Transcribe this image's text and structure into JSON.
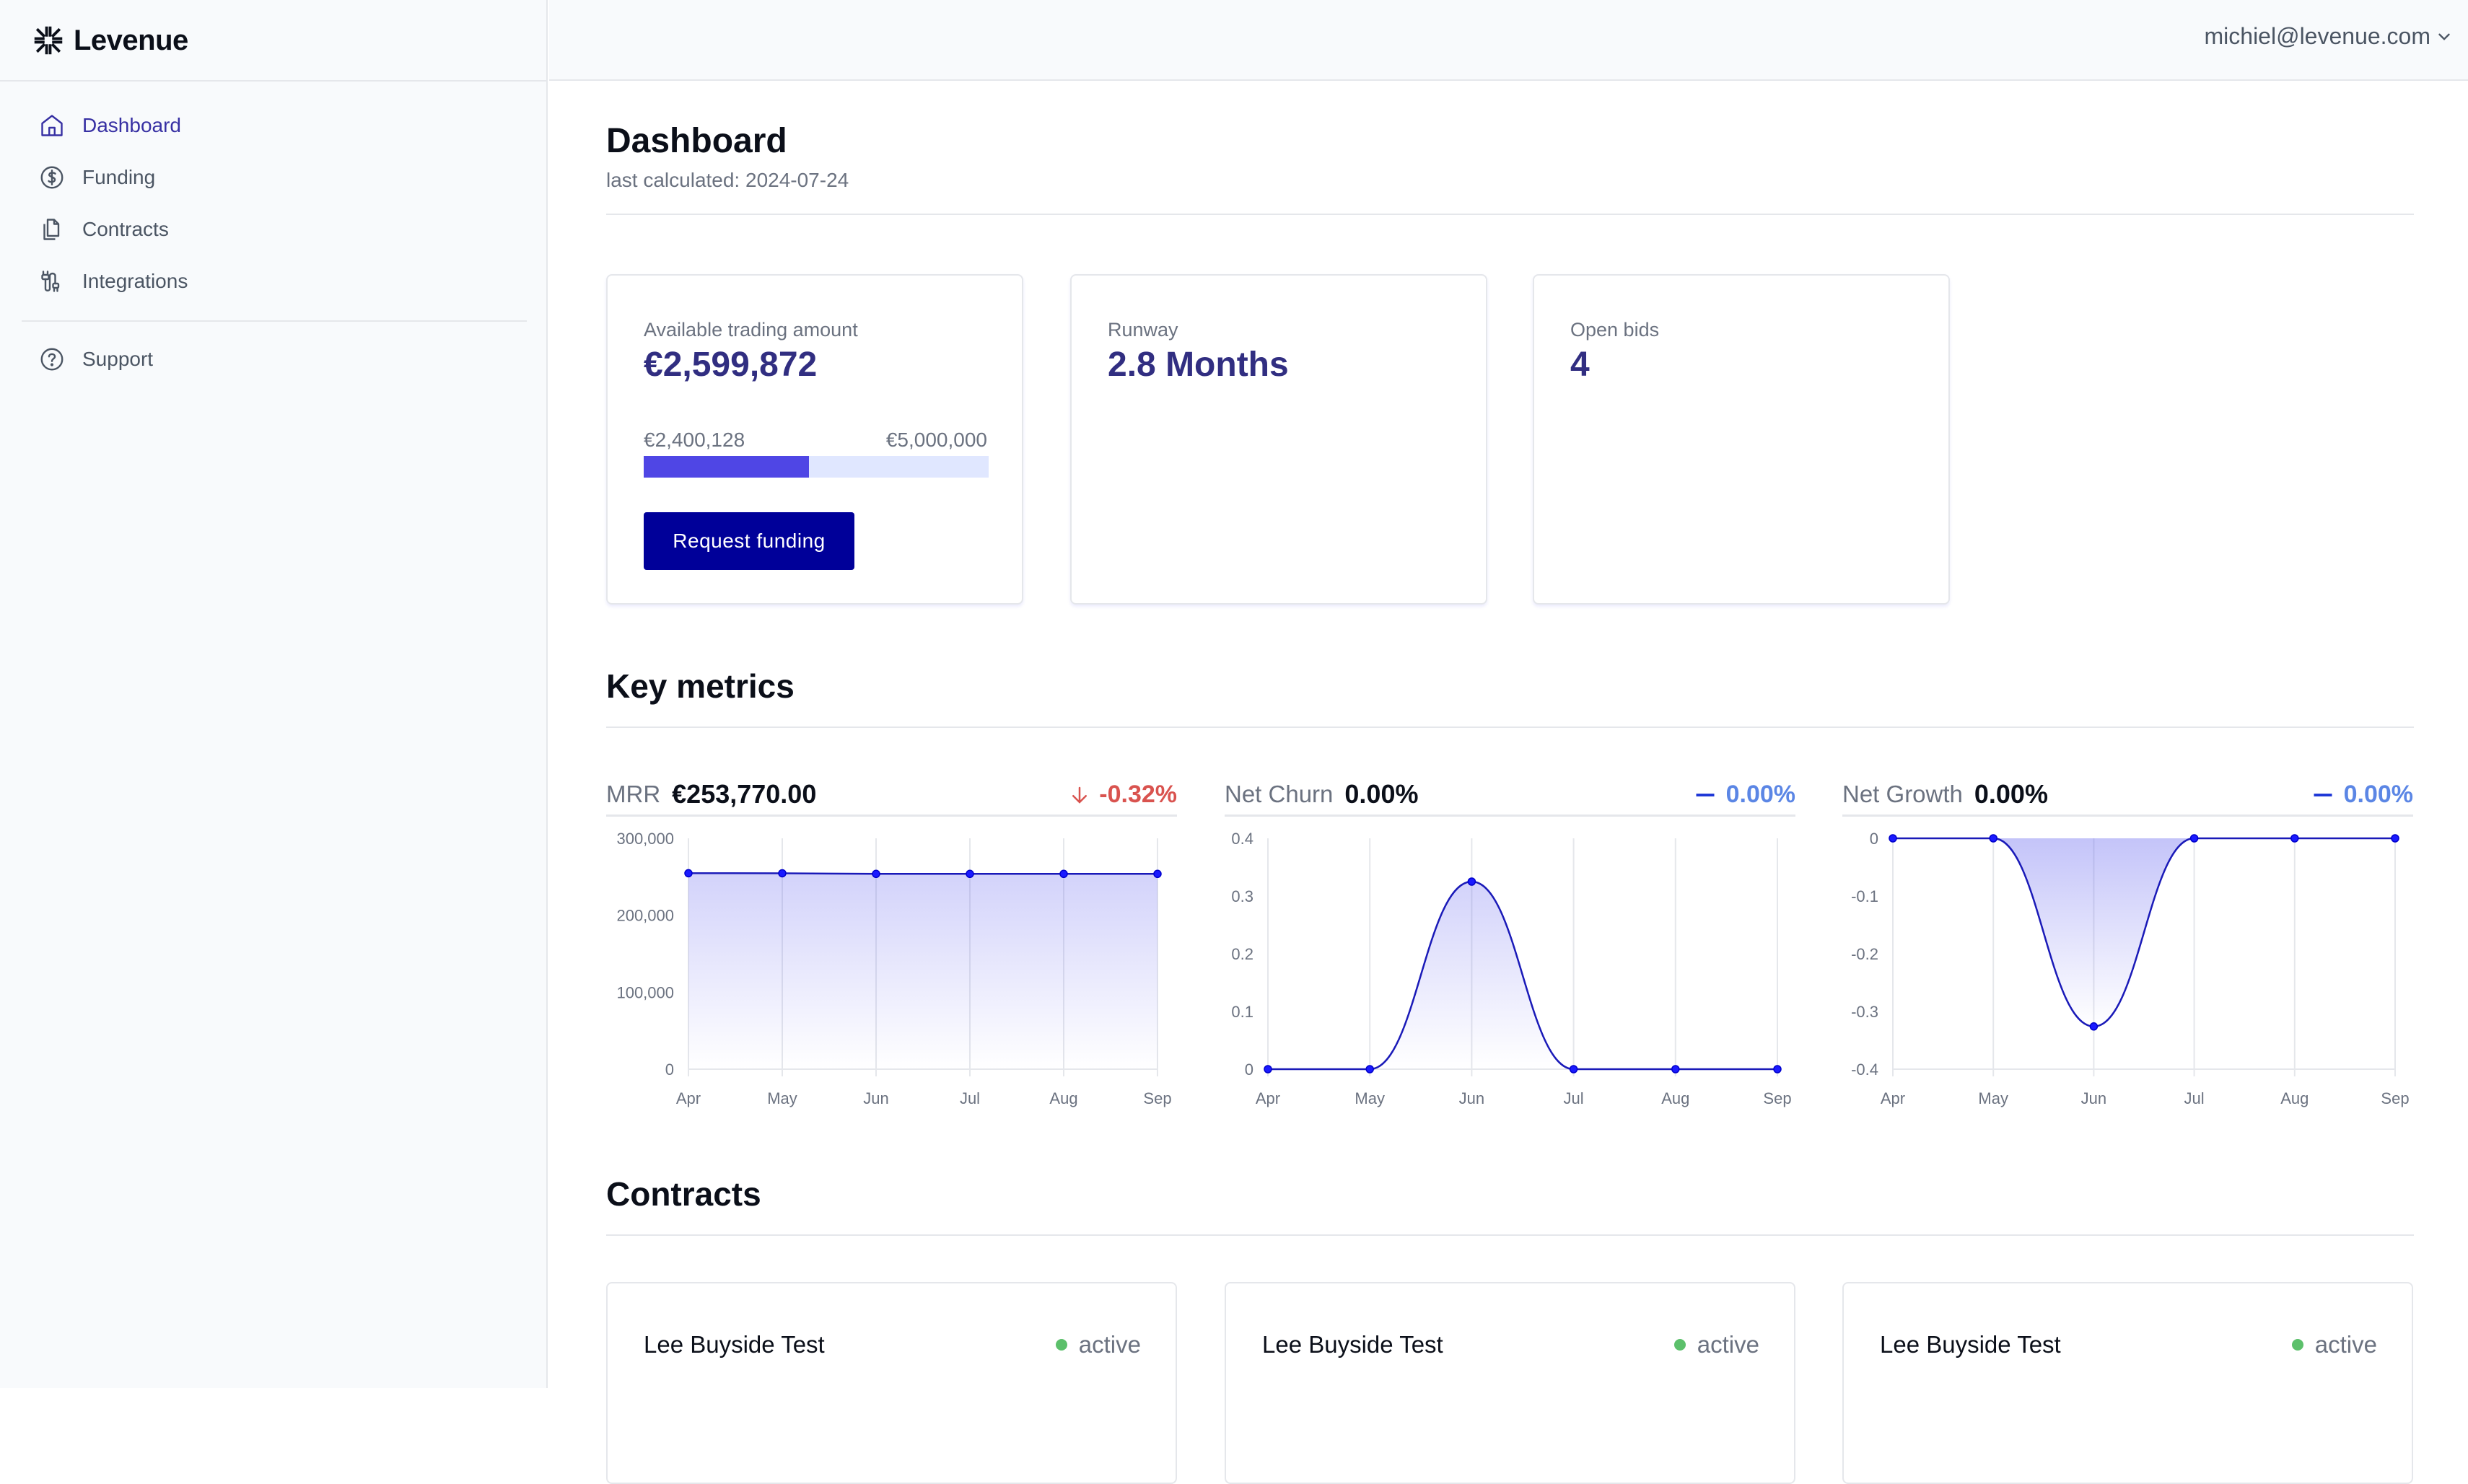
{
  "app": {
    "name": "Levenue"
  },
  "sidebar": {
    "items": [
      {
        "label": "Dashboard",
        "icon": "home-icon",
        "active": true
      },
      {
        "label": "Funding",
        "icon": "dollar-circle-icon",
        "active": false
      },
      {
        "label": "Contracts",
        "icon": "documents-icon",
        "active": false
      },
      {
        "label": "Integrations",
        "icon": "plug-icon",
        "active": false
      }
    ],
    "secondary": [
      {
        "label": "Support",
        "icon": "question-circle-icon"
      }
    ]
  },
  "header": {
    "user_email": "michiel@levenue.com"
  },
  "page": {
    "title": "Dashboard",
    "subtitle": "last calculated: 2024-07-24"
  },
  "cards": {
    "trading": {
      "label": "Available trading amount",
      "value": "€2,599,872",
      "used_label": "€2,400,128",
      "limit_label": "€5,000,000",
      "progress_fraction": 0.48,
      "button_label": "Request funding"
    },
    "runway": {
      "label": "Runway",
      "value": "2.8 Months"
    },
    "bids": {
      "label": "Open bids",
      "value": "4"
    }
  },
  "sections": {
    "key_metrics": "Key metrics",
    "contracts": "Contracts"
  },
  "colors": {
    "accent": "#4f46e5",
    "line": "#1a1ab8",
    "negative": "#d9534f",
    "neutral_change": "#5b86e5",
    "active_status": "#5cc06b"
  },
  "metrics": [
    {
      "name": "MRR",
      "value": "€253,770.00",
      "change": "-0.32%",
      "trend": "down"
    },
    {
      "name": "Net Churn",
      "value": "0.00%",
      "change": "0.00%",
      "trend": "flat"
    },
    {
      "name": "Net Growth",
      "value": "0.00%",
      "change": "0.00%",
      "trend": "flat"
    }
  ],
  "chart_data": [
    {
      "type": "area",
      "title": "MRR",
      "categories": [
        "Apr",
        "May",
        "Jun",
        "Jul",
        "Aug",
        "Sep"
      ],
      "values": [
        254600,
        254585,
        253770,
        253770,
        253770,
        253770
      ],
      "ylim": [
        0,
        300000
      ],
      "yticks": [
        0,
        100000,
        200000,
        300000
      ],
      "ytick_labels": [
        "0",
        "100,000",
        "200,000",
        "300,000"
      ],
      "grid": true,
      "smooth": false
    },
    {
      "type": "area",
      "title": "Net Churn",
      "categories": [
        "Apr",
        "May",
        "Jun",
        "Jul",
        "Aug",
        "Sep"
      ],
      "values": [
        0,
        0,
        0.325,
        0,
        0,
        0
      ],
      "ylim": [
        0,
        0.4
      ],
      "yticks": [
        0,
        0.1,
        0.2,
        0.3,
        0.4
      ],
      "ytick_labels": [
        "0",
        "0.1",
        "0.2",
        "0.3",
        "0.4"
      ],
      "grid": true,
      "smooth": true
    },
    {
      "type": "area",
      "title": "Net Growth",
      "categories": [
        "Apr",
        "May",
        "Jun",
        "Jul",
        "Aug",
        "Sep"
      ],
      "values": [
        0,
        0,
        -0.326,
        0,
        0,
        0
      ],
      "ylim": [
        -0.4,
        0
      ],
      "yticks": [
        -0.4,
        -0.3,
        -0.2,
        -0.1,
        0
      ],
      "ytick_labels": [
        "-0.4",
        "-0.3",
        "-0.2",
        "-0.1",
        "0"
      ],
      "grid": true,
      "smooth": true,
      "fill_to": "top"
    }
  ],
  "contracts": [
    {
      "name": "Lee Buyside Test",
      "status": "active"
    },
    {
      "name": "Lee Buyside Test",
      "status": "active"
    },
    {
      "name": "Lee Buyside Test",
      "status": "active"
    }
  ]
}
